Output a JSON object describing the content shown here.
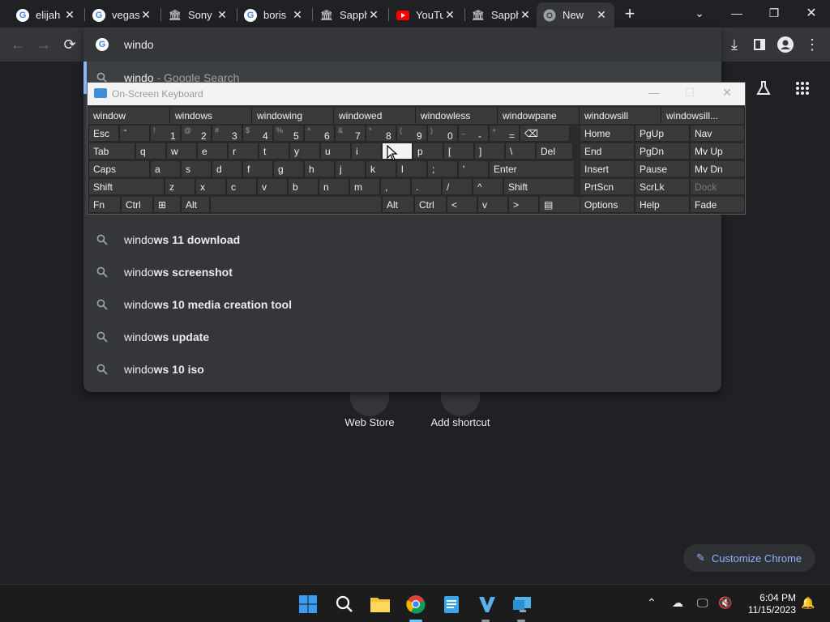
{
  "tabs": [
    {
      "title": "elijah",
      "icon": "google-icon"
    },
    {
      "title": "vegas",
      "icon": "google-icon"
    },
    {
      "title": "Sony",
      "icon": "bank-icon"
    },
    {
      "title": "boris",
      "icon": "google-icon"
    },
    {
      "title": "Sapph",
      "icon": "bank-icon"
    },
    {
      "title": "YouTu",
      "icon": "youtube-icon"
    },
    {
      "title": "Sapph",
      "icon": "bank-icon"
    },
    {
      "title": "New",
      "icon": "chrome-icon",
      "active": true
    }
  ],
  "omnibox": {
    "input": "windo",
    "first_suggestion": {
      "typed": "windo",
      "suffix": " - Google Search"
    },
    "suggestions": [
      {
        "typed": "windo",
        "rest": "ws 11 download"
      },
      {
        "typed": "windo",
        "rest": "ws screenshot"
      },
      {
        "typed": "windo",
        "rest": "ws 10 media creation tool"
      },
      {
        "typed": "windo",
        "rest": "ws update"
      },
      {
        "typed": "windo",
        "rest": "ws 10 iso"
      }
    ]
  },
  "ntp": {
    "shortcuts": [
      "Web Store",
      "Add shortcut"
    ],
    "customize": "Customize Chrome"
  },
  "osk": {
    "title": "On-Screen Keyboard",
    "predictions": [
      "window",
      "windows",
      "windowing",
      "windowed",
      "windowless",
      "windowpane",
      "windowsill",
      "windowsill..."
    ],
    "row1": [
      {
        "main": "Esc"
      },
      {
        "shift": "~",
        "main": "`"
      },
      {
        "shift": "!",
        "num": "1"
      },
      {
        "shift": "@",
        "num": "2"
      },
      {
        "shift": "#",
        "num": "3"
      },
      {
        "shift": "$",
        "num": "4"
      },
      {
        "shift": "%",
        "num": "5"
      },
      {
        "shift": "^",
        "num": "6"
      },
      {
        "shift": "&",
        "num": "7"
      },
      {
        "shift": "*",
        "num": "8"
      },
      {
        "shift": "(",
        "num": "9"
      },
      {
        "shift": ")",
        "num": "0"
      },
      {
        "shift": "_",
        "num": "-"
      },
      {
        "shift": "+",
        "num": "="
      },
      {
        "main": "⌫"
      }
    ],
    "row2": [
      "Tab",
      "q",
      "w",
      "e",
      "r",
      "t",
      "y",
      "u",
      "i",
      "o",
      "p",
      "[",
      "]",
      "\\",
      "Del"
    ],
    "row3": [
      "Caps",
      "a",
      "s",
      "d",
      "f",
      "g",
      "h",
      "j",
      "k",
      "l",
      ";",
      "'",
      "Enter"
    ],
    "row4": [
      "Shift",
      "z",
      "x",
      "c",
      "v",
      "b",
      "n",
      "m",
      ",",
      ".",
      "/",
      "^",
      "Shift"
    ],
    "row5": [
      "Fn",
      "Ctrl",
      "⊞",
      "Alt",
      "",
      "Alt",
      "Ctrl",
      "<",
      "v",
      ">",
      "▤"
    ],
    "nav": [
      [
        "Home",
        "PgUp",
        "Nav"
      ],
      [
        "End",
        "PgDn",
        "Mv Up"
      ],
      [
        "Insert",
        "Pause",
        "Mv Dn"
      ],
      [
        "PrtScn",
        "ScrLk",
        "Dock"
      ],
      [
        "Options",
        "Help",
        "Fade"
      ]
    ]
  },
  "taskbar": {
    "time": "6:04 PM",
    "date": "11/15/2023"
  },
  "colors": {
    "accent": "#8ab4f8",
    "bg": "#202124",
    "surface": "#35363a"
  }
}
